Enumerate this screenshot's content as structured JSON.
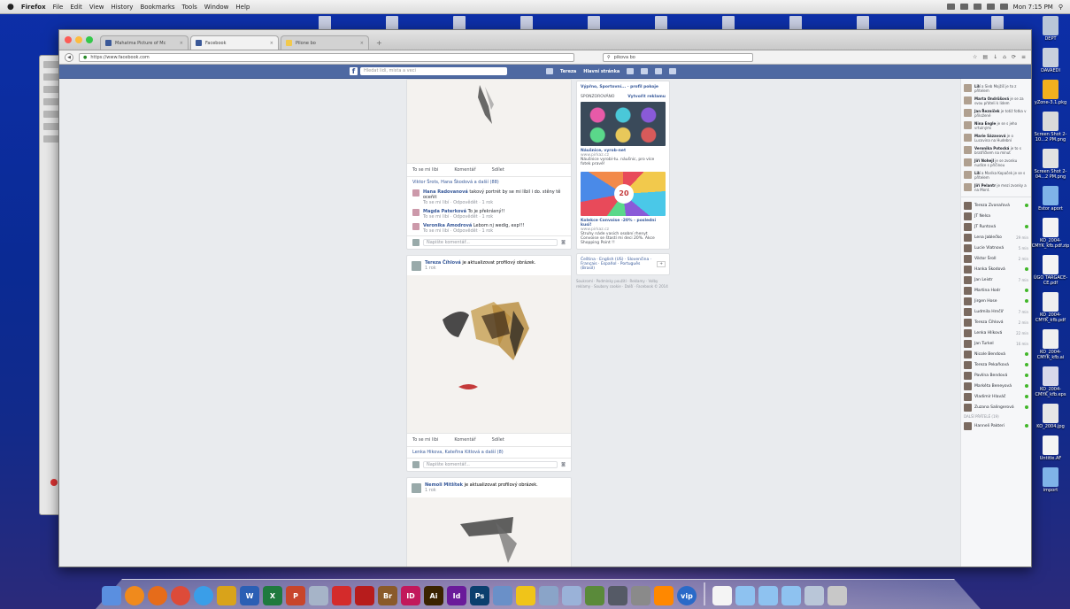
{
  "menubar": {
    "apple": "",
    "app_name": "Firefox",
    "items": [
      "File",
      "Edit",
      "View",
      "History",
      "Bookmarks",
      "Tools",
      "Window",
      "Help"
    ],
    "clock": "Mon 7:15 PM"
  },
  "browser": {
    "tabs": [
      {
        "label": "Mahatma Picture of Mc",
        "icon": "page-icon"
      },
      {
        "label": "Facebook",
        "icon": "facebook-icon"
      },
      {
        "label": "Pilone bo",
        "icon": "spreadsheet-icon"
      }
    ],
    "url": "https://www.facebook.com",
    "search_value": "pikova bo"
  },
  "facebook": {
    "logo": "f",
    "search_placeholder": "Hledat lidi, mista a veci",
    "nav": [
      "Tereza",
      "Hlavní stránka"
    ],
    "feed": {
      "post1": {
        "actions": [
          "To se mi libi",
          "Komentář",
          "Sdílet"
        ],
        "likes": "Viktor Šrots, Hana Škodová a další (88)",
        "comments": [
          {
            "name": "Hana Radovanová",
            "text": "takový portrét by se mi líbil i do. stěny tě oceňit",
            "meta": "To se mi libí · Odpovědět · 1 rok"
          },
          {
            "name": "Magda Paterková",
            "text": "To je překrásný!!",
            "meta": "To se mi libí · Odpovědět · 1 rok"
          },
          {
            "name": "Veronika Amodrová",
            "text": "Lebom nj wedig, exp!!!",
            "meta": "To se mi libí · Odpovědět · 1 rok"
          }
        ],
        "write_placeholder": "Napište komentář..."
      },
      "post2": {
        "author": "Tereza Číhlová",
        "verb": "je aktualizovat profilový obrázek.",
        "time": "1 rok",
        "actions": [
          "To se mi libi",
          "Komentář",
          "Sdílet"
        ],
        "likes": "Lenka Hikova, Kateřina Kitlová a další (8)",
        "write_placeholder": "Napište komentář..."
      },
      "post3": {
        "author": "Nemoli Mitlítek",
        "verb": "je aktualizovat profilový obrázek.",
        "time": "1 rok"
      }
    },
    "ads": {
      "header": "Výpřno, Sportovní... · profil pokoje",
      "sponsored": "SPONZOROVÁNO",
      "create_ad": "Vytvořit reklamu",
      "ad1_name": "Náušnice, vyrob-net",
      "ad1_url": "www.pirkaz.cz",
      "ad1_text": "Náušnice vyrobí-tu. náušnic, pro více fotek pravé!",
      "ad2_name": "Kolekce Convoise -20% - posledni kusi!",
      "ad2_url": "www.pirkaz.cz",
      "ad2_text": "Struhy náde vasich osobní rhenyt Convoise se štastí mi deci 20%. Akce Shopping Point !!",
      "ad2_badge": "20",
      "languages": "Čeština · English (US) · Slovenčina · Français · Español · Português (Brasil)",
      "footer": "Soukromí · Podmínky použití · Reklamy · Volby reklamy · Soubory cookie · Další · Facebook © 2014"
    },
    "chat": {
      "ticker": [
        {
          "name": "Lilí",
          "text": "a Sieb Mojžiš je to z přítelem"
        },
        {
          "name": "Marta Ondrůšová",
          "text": "je se za svou přáteli k lidem"
        },
        {
          "name": "Jan Řezníček",
          "text": "je totiž fotka v přiložené"
        },
        {
          "name": "Nina Engle",
          "text": "je se s jeho vrtulnými"
        },
        {
          "name": "Marie Sázavová",
          "text": "je o Lucovina na Hudební"
        },
        {
          "name": "Veronika Potocká",
          "text": "je to s bratříčkem na mínut"
        },
        {
          "name": "Jiří Nohejl",
          "text": "je se zvonku nudíce s příčinou"
        },
        {
          "name": "Lilí",
          "text": "a Marika Kopaček je se s přítelem"
        },
        {
          "name": "Jiří Pelantr",
          "text": "je mezi zvonky a na Mont."
        }
      ],
      "contacts": [
        {
          "name": "Tereza Zvonařová",
          "status": "online"
        },
        {
          "name": "JT Nelsa",
          "status": ""
        },
        {
          "name": "JT Runtová",
          "status": "online"
        },
        {
          "name": "Lena Jablečko",
          "status": "29 min"
        },
        {
          "name": "Lucie Vlatnová",
          "status": "5 min"
        },
        {
          "name": "Viktor Šroll",
          "status": "2 min"
        },
        {
          "name": "Hanka Škodová",
          "status": "online"
        },
        {
          "name": "Jan Leistr",
          "status": "7 min"
        },
        {
          "name": "Martina Hodr",
          "status": "online"
        },
        {
          "name": "Jirgen Hose",
          "status": "online"
        },
        {
          "name": "Ludmila Hrnčíř",
          "status": "7 min"
        },
        {
          "name": "Tereza Číhlová",
          "status": "2 min"
        },
        {
          "name": "Lenka Hlíková",
          "status": "22 min"
        },
        {
          "name": "Jan Turkel",
          "status": "16 min"
        },
        {
          "name": "Nicole Bendová",
          "status": "online"
        },
        {
          "name": "Tereza Pekařková",
          "status": "online"
        },
        {
          "name": "Pavlína Bendová",
          "status": "online"
        },
        {
          "name": "Markéta Beneyová",
          "status": "online"
        },
        {
          "name": "Vladimír Hlaváč",
          "status": "online"
        },
        {
          "name": "Zuzana Salingerová",
          "status": "online"
        }
      ],
      "section": "DALŠÍ PŘÁTELÉ (19)",
      "last": {
        "name": "Hanneli Pakteri",
        "status": "online"
      }
    }
  },
  "desktop": {
    "icons": [
      {
        "label": "DEPT",
        "color": "#b9c6d8"
      },
      {
        "label": "DAVAEDI",
        "color": "#c8d0dd"
      },
      {
        "label": "yZone-3.1.pkg",
        "color": "#f2b01e"
      },
      {
        "label": "Screen Shot 2-10...2 PM.png",
        "color": "#dadada"
      },
      {
        "label": "Screen Shot 2-04...2 PM.png",
        "color": "#e2e2e2"
      },
      {
        "label": "Estor aport",
        "color": "#7fb3e8"
      },
      {
        "label": "KO_2004-CMYK_kfb.pdf.zip",
        "color": "#f4f4f4"
      },
      {
        "label": "ÚGO TARGACE-CE.pdf",
        "color": "#f4f4f4"
      },
      {
        "label": "KO_2004-CMYK_kfb.pdf",
        "color": "#f0f0f0"
      },
      {
        "label": "KO_2004-CMYK_kfb.ai",
        "color": "#f0f0f0"
      },
      {
        "label": "KO_2004-CMYK_kfb.eps",
        "color": "#d8d8ea"
      },
      {
        "label": "KO_2004.jpg",
        "color": "#e6e6e6"
      },
      {
        "label": "Untitle.AF",
        "color": "#f4f4f4"
      },
      {
        "label": "import",
        "color": "#7fb3e8"
      }
    ]
  },
  "dock": {
    "apps": [
      {
        "name": "finder",
        "label": "",
        "color": "#5a8fe0"
      },
      {
        "name": "ibooks",
        "label": "",
        "color": "#f08a1c"
      },
      {
        "name": "firefox",
        "label": "",
        "color": "#e66c1a"
      },
      {
        "name": "chrome",
        "label": "",
        "color": "#dd4b39"
      },
      {
        "name": "safari",
        "label": "",
        "color": "#3a9ee8"
      },
      {
        "name": "filezilla",
        "label": "",
        "color": "#d9a31a"
      },
      {
        "name": "word",
        "label": "W",
        "color": "#2b5fb4"
      },
      {
        "name": "excel",
        "label": "X",
        "color": "#1f7a3e"
      },
      {
        "name": "powerpoint",
        "label": "P",
        "color": "#c8452c"
      },
      {
        "name": "preview",
        "label": "",
        "color": "#a6b4c8"
      },
      {
        "name": "acrobat",
        "label": "",
        "color": "#d42b2b"
      },
      {
        "name": "acrobat-pro",
        "label": "",
        "color": "#b71c1c"
      },
      {
        "name": "bridge",
        "label": "Br",
        "color": "#8a5a2a"
      },
      {
        "name": "indesign",
        "label": "ID",
        "color": "#c2185b"
      },
      {
        "name": "illustrator",
        "label": "Ai",
        "color": "#3a2300"
      },
      {
        "name": "incopy",
        "label": "Id",
        "color": "#6a1b9a"
      },
      {
        "name": "photoshop",
        "label": "Ps",
        "color": "#0b3f6e"
      },
      {
        "name": "calculator",
        "label": "",
        "color": "#6a90c8"
      },
      {
        "name": "cyberduck",
        "label": "",
        "color": "#f0c419"
      },
      {
        "name": "photos",
        "label": "",
        "color": "#8aa4c8"
      },
      {
        "name": "script",
        "label": "",
        "color": "#9ab2d8"
      },
      {
        "name": "utility",
        "label": "",
        "color": "#5a8a3a"
      },
      {
        "name": "disk-utility",
        "label": "",
        "color": "#555a66"
      },
      {
        "name": "automator",
        "label": "",
        "color": "#8a8a8a"
      },
      {
        "name": "vlc",
        "label": "",
        "color": "#ff8800"
      },
      {
        "name": "vip",
        "label": "vip",
        "color": "#2a6ac8"
      }
    ],
    "right_items": [
      {
        "name": "document",
        "color": "#f4f4f4"
      },
      {
        "name": "folder",
        "color": "#8ec2f0"
      },
      {
        "name": "folder",
        "color": "#8ec2f0"
      },
      {
        "name": "folder",
        "color": "#8ec2f0"
      },
      {
        "name": "downloads",
        "color": "#b9c6d8"
      },
      {
        "name": "trash",
        "color": "#c8c8c8"
      }
    ]
  }
}
